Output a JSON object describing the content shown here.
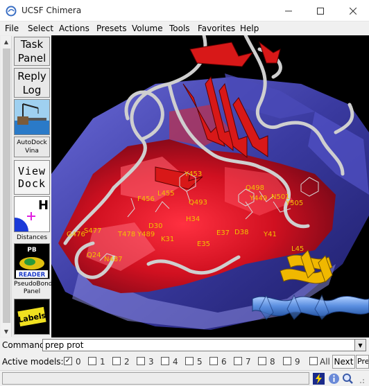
{
  "window": {
    "title": "UCSF Chimera"
  },
  "menubar": {
    "items": [
      "File",
      "Select",
      "Actions",
      "Presets",
      "Volume",
      "Tools",
      "Favorites",
      "Help"
    ]
  },
  "toolbar": {
    "task_panel_line1": "Task",
    "task_panel_line2": "Panel",
    "reply_log_line1": "Reply",
    "reply_log_line2": "Log",
    "autodock_line1": "AutoDock",
    "autodock_line2": "Vina",
    "viewdock_line1": "View",
    "viewdock_line2": "Dock",
    "distances": "Distances",
    "pb_reader_line1": "PB",
    "pb_reader_line2": "READER",
    "pseudobond_line1": "PseudoBond",
    "pseudobond_line2": "Panel",
    "labels": "Labels"
  },
  "residue_labels": [
    "Y453",
    "L455",
    "F456",
    "Q493",
    "Q498",
    "Y449",
    "N501",
    "Y505",
    "H34",
    "D30",
    "K31",
    "E35",
    "E37",
    "D38",
    "Y41",
    "G476",
    "S477",
    "T478",
    "Y489",
    "Q24",
    "N487",
    "L45"
  ],
  "command": {
    "label": "Command:",
    "value": "prep prot"
  },
  "active_models": {
    "label": "Active models:",
    "models": [
      {
        "id": "0",
        "checked": true
      },
      {
        "id": "1",
        "checked": false
      },
      {
        "id": "2",
        "checked": false
      },
      {
        "id": "3",
        "checked": false
      },
      {
        "id": "4",
        "checked": false
      },
      {
        "id": "5",
        "checked": false
      },
      {
        "id": "6",
        "checked": false
      },
      {
        "id": "7",
        "checked": false
      },
      {
        "id": "8",
        "checked": false
      },
      {
        "id": "9",
        "checked": false
      }
    ],
    "all_label": "All",
    "next_label": "Next",
    "prev_label": "Previous"
  },
  "colors": {
    "surface_red": "#e01020",
    "surface_blue": "#3a3aa8",
    "ribbon_red": "#d81818",
    "helix_gold": "#f0b800",
    "helix_blue": "#5a8ee0",
    "label_yellow": "#f2c200"
  }
}
